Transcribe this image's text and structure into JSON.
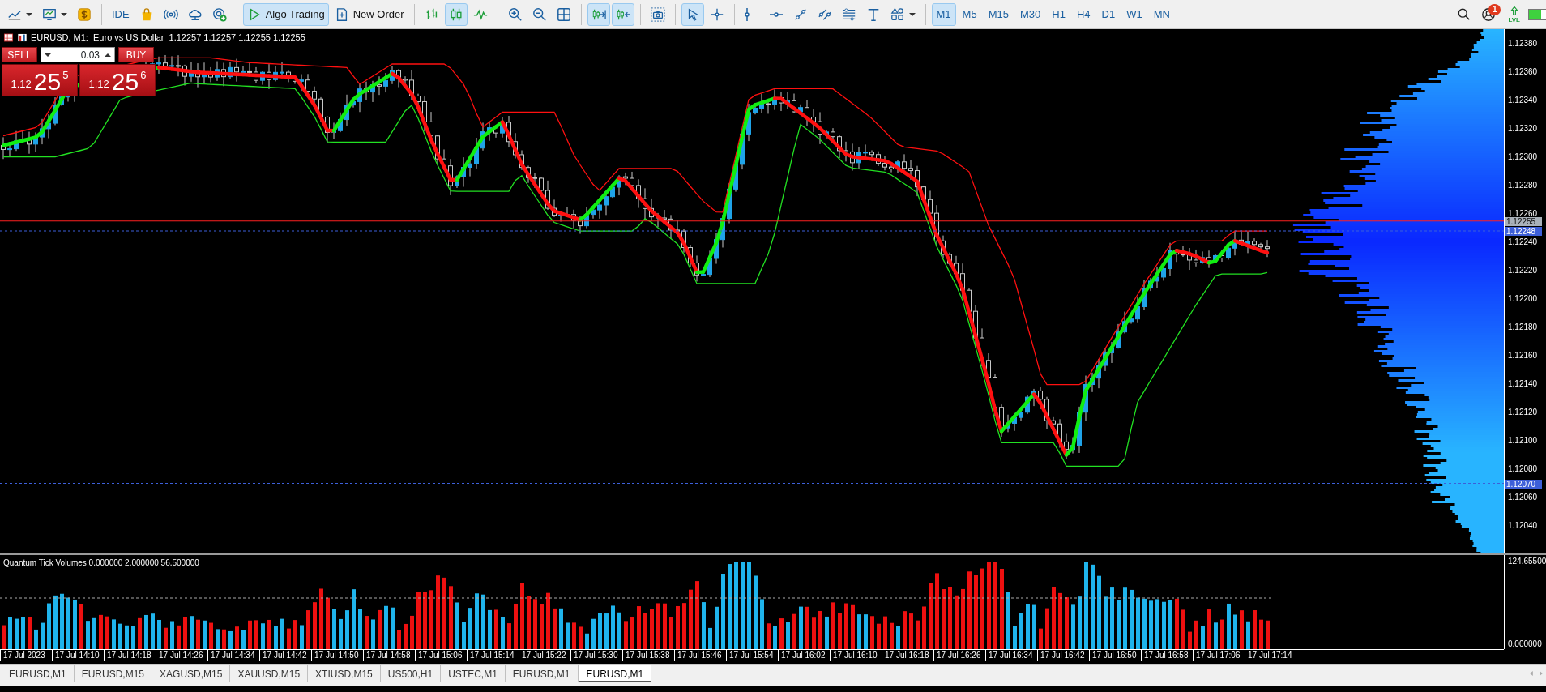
{
  "toolbar": {
    "items": [
      {
        "kind": "chart-type",
        "dropdown": true,
        "on": false
      },
      {
        "kind": "templates",
        "dropdown": true,
        "on": false
      },
      {
        "kind": "dollar",
        "on": false
      },
      {
        "kind": "separator"
      },
      {
        "kind": "text",
        "label": "IDE",
        "on": false
      },
      {
        "kind": "bag",
        "on": false
      },
      {
        "kind": "signal",
        "on": false
      },
      {
        "kind": "cloud",
        "on": false
      },
      {
        "kind": "globe",
        "on": false
      },
      {
        "kind": "separator"
      },
      {
        "kind": "play",
        "label": "Algo Trading",
        "on": true
      },
      {
        "kind": "order",
        "label": "New Order",
        "on": false
      },
      {
        "kind": "separator"
      },
      {
        "kind": "bars",
        "on": false
      },
      {
        "kind": "candles",
        "on": true
      },
      {
        "kind": "line",
        "on": false
      },
      {
        "kind": "separator"
      },
      {
        "kind": "zoom-in",
        "on": false
      },
      {
        "kind": "zoom-out",
        "on": false
      },
      {
        "kind": "tile",
        "on": false
      },
      {
        "kind": "separator"
      },
      {
        "kind": "autoscroll",
        "on": true
      },
      {
        "kind": "shift",
        "on": true
      },
      {
        "kind": "separator"
      },
      {
        "kind": "camera",
        "on": false
      },
      {
        "kind": "separator"
      },
      {
        "kind": "cursor",
        "on": true
      },
      {
        "kind": "crosshair",
        "on": false
      },
      {
        "kind": "separator"
      },
      {
        "kind": "vline",
        "on": false
      },
      {
        "kind": "hline",
        "on": false
      },
      {
        "kind": "trend",
        "on": false
      },
      {
        "kind": "channel",
        "on": false
      },
      {
        "kind": "fibo",
        "on": false
      },
      {
        "kind": "text-tool",
        "on": false
      },
      {
        "kind": "shapes",
        "dropdown": true,
        "on": false
      }
    ],
    "timeframes": [
      {
        "label": "M1",
        "selected": true
      },
      {
        "label": "M5",
        "selected": false
      },
      {
        "label": "M15",
        "selected": false
      },
      {
        "label": "M30",
        "selected": false
      },
      {
        "label": "H1",
        "selected": false
      },
      {
        "label": "H4",
        "selected": false
      },
      {
        "label": "D1",
        "selected": false
      },
      {
        "label": "W1",
        "selected": false
      },
      {
        "label": "MN",
        "selected": false
      }
    ],
    "notifications": "1",
    "lvl": "LVL"
  },
  "chart": {
    "header": "EURUSD, M1:  Euro vs US Dollar  1.12257 1.12257 1.12255 1.12255",
    "trade_panel": {
      "sell": "SELL",
      "buy": "BUY",
      "volume": "0.03",
      "bid": {
        "prefix": "1.12",
        "main": "25",
        "sup": "5"
      },
      "ask": {
        "prefix": "1.12",
        "main": "25",
        "sup": "6"
      }
    },
    "price_labels": [
      "1.12380",
      "1.12360",
      "1.12340",
      "1.12320",
      "1.12300",
      "1.12280",
      "1.12260",
      "1.12240",
      "1.12220",
      "1.12200",
      "1.12180",
      "1.12160",
      "1.12140",
      "1.12120",
      "1.12100",
      "1.12080",
      "1.12060",
      "1.12040"
    ],
    "price_tags": [
      {
        "text": "1.12255",
        "color": "#a9b1ba",
        "kind": "bid"
      },
      {
        "text": "1.12248",
        "color": "#3d5fd9",
        "kind": "level"
      },
      {
        "text": "1.12070",
        "color": "#3d5fd9",
        "kind": "level"
      }
    ]
  },
  "volume_pane": {
    "header": "Quantum Tick Volumes 0.000000 2.000000 56.500000",
    "scale": [
      "124.65500",
      "0.000000"
    ]
  },
  "time_labels": [
    "17 Jul 2023",
    "17 Jul 14:10",
    "17 Jul 14:18",
    "17 Jul 14:26",
    "17 Jul 14:34",
    "17 Jul 14:42",
    "17 Jul 14:50",
    "17 Jul 14:58",
    "17 Jul 15:06",
    "17 Jul 15:14",
    "17 Jul 15:22",
    "17 Jul 15:30",
    "17 Jul 15:38",
    "17 Jul 15:46",
    "17 Jul 15:54",
    "17 Jul 16:02",
    "17 Jul 16:10",
    "17 Jul 16:18",
    "17 Jul 16:26",
    "17 Jul 16:34",
    "17 Jul 16:42",
    "17 Jul 16:50",
    "17 Jul 16:58",
    "17 Jul 17:06",
    "17 Jul 17:14"
  ],
  "tabs": [
    {
      "label": "EURUSD,M1",
      "selected": false
    },
    {
      "label": "EURUSD,M15",
      "selected": false
    },
    {
      "label": "XAGUSD,M15",
      "selected": false
    },
    {
      "label": "XAUUSD,M15",
      "selected": false
    },
    {
      "label": "XTIUSD,M15",
      "selected": false
    },
    {
      "label": "US500,H1",
      "selected": false
    },
    {
      "label": "USTEC,M1",
      "selected": false
    },
    {
      "label": "EURUSD,M1",
      "selected": false
    },
    {
      "label": "EURUSD,M1",
      "selected": true
    }
  ]
}
